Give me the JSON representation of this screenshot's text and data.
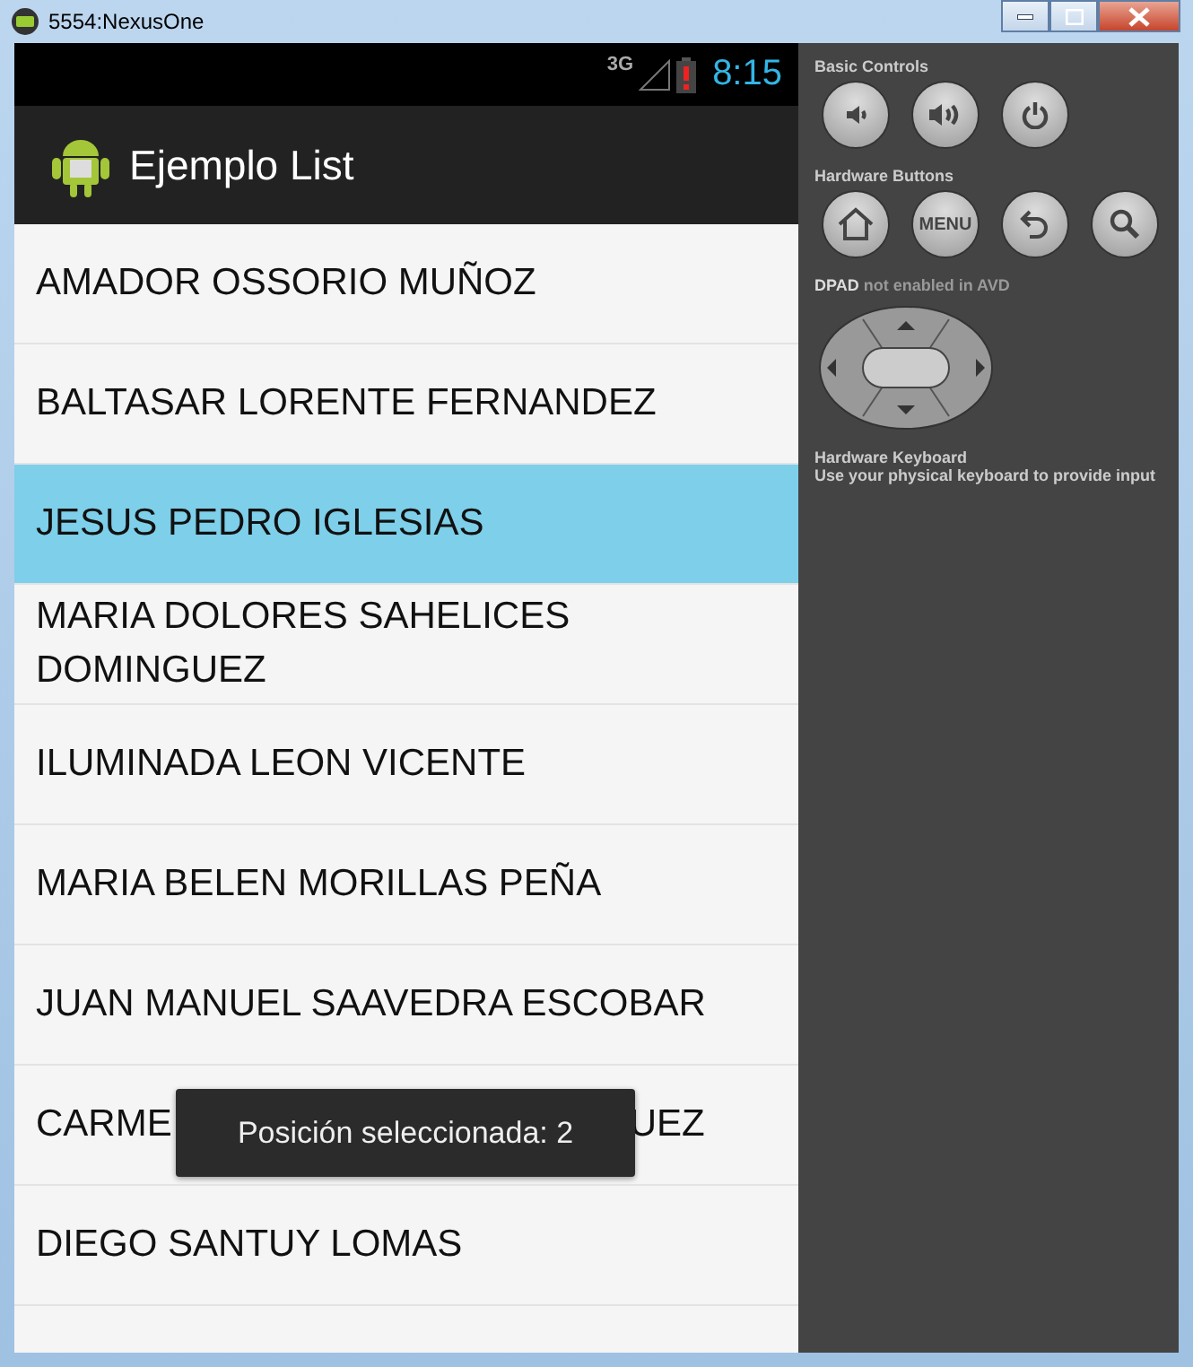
{
  "window": {
    "title": "5554:NexusOne"
  },
  "status_bar": {
    "network": "3G",
    "time": "8:15"
  },
  "action_bar": {
    "title": "Ejemplo List"
  },
  "list": {
    "items": [
      {
        "text": "AMADOR OSSORIO MUÑOZ",
        "selected": false
      },
      {
        "text": "BALTASAR LORENTE FERNANDEZ",
        "selected": false
      },
      {
        "text": "JESUS PEDRO IGLESIAS",
        "selected": true
      },
      {
        "text": "MARIA DOLORES SAHELICES DOMINGUEZ",
        "selected": false
      },
      {
        "text": "ILUMINADA LEON VICENTE",
        "selected": false
      },
      {
        "text": "MARIA BELEN MORILLAS PEÑA",
        "selected": false
      },
      {
        "text": "JUAN MANUEL SAAVEDRA ESCOBAR",
        "selected": false
      },
      {
        "parts": [
          "CARME",
          "UEZ"
        ],
        "selected": false
      },
      {
        "text": "DIEGO SANTUY LOMAS",
        "selected": false
      }
    ]
  },
  "toast": {
    "text": "Posición seleccionada: 2"
  },
  "controls_panel": {
    "sections": [
      {
        "title": "Basic Controls",
        "buttons": [
          {
            "kind": "volume-down"
          },
          {
            "kind": "volume-up"
          },
          {
            "kind": "power"
          }
        ]
      },
      {
        "title": "Hardware Buttons",
        "buttons": [
          {
            "kind": "home"
          },
          {
            "kind": "menu",
            "label": "MENU"
          },
          {
            "kind": "back"
          },
          {
            "kind": "search"
          }
        ]
      }
    ],
    "dpad_note": "**DPAD** not enabled in AVD",
    "keyboard_title": "Hardware Keyboard",
    "keyboard_note": "Use your physical keyboard to provide input"
  }
}
